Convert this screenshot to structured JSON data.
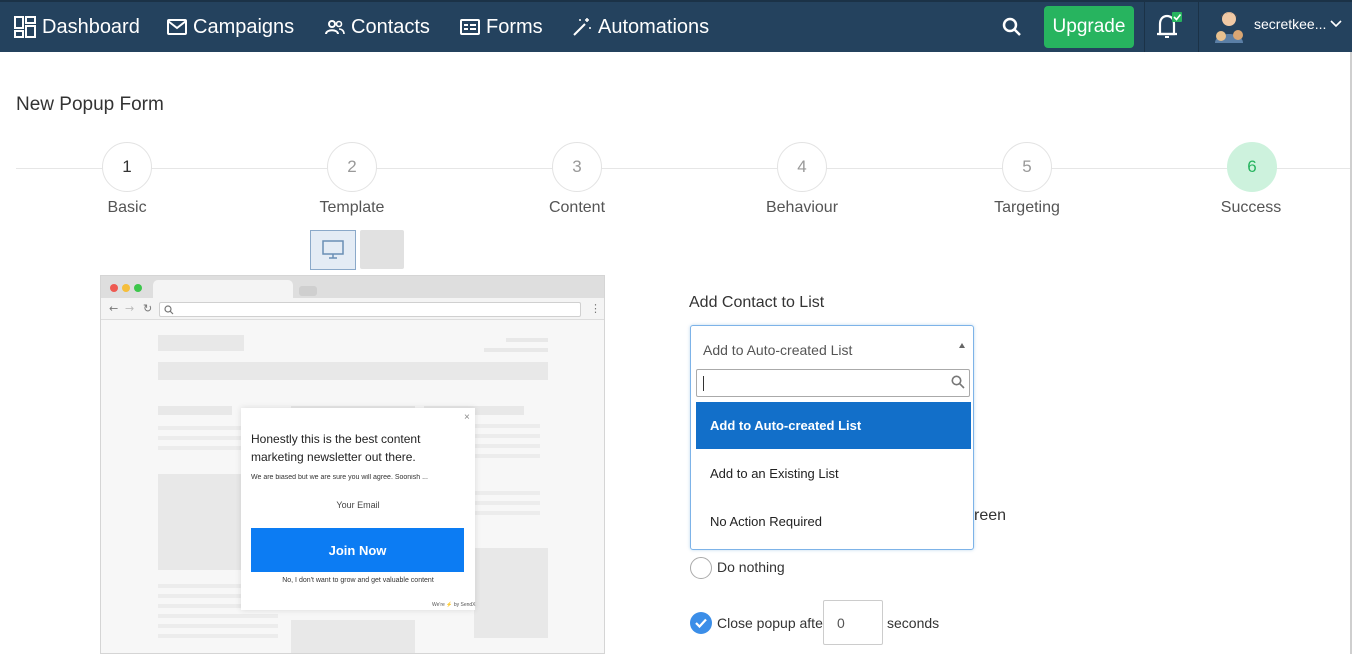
{
  "nav": {
    "items": [
      {
        "label": "Dashboard",
        "icon": "dashboard-icon"
      },
      {
        "label": "Campaigns",
        "icon": "envelope-icon"
      },
      {
        "label": "Contacts",
        "icon": "users-icon"
      },
      {
        "label": "Forms",
        "icon": "form-icon"
      },
      {
        "label": "Automations",
        "icon": "magic-wand-icon"
      }
    ],
    "upgrade_label": "Upgrade",
    "username": "secretkee...",
    "colors": {
      "bar": "#24425e",
      "upgrade": "#27b45f"
    }
  },
  "page": {
    "title": "New Popup Form"
  },
  "steps": [
    {
      "num": "1",
      "label": "Basic"
    },
    {
      "num": "2",
      "label": "Template"
    },
    {
      "num": "3",
      "label": "Content"
    },
    {
      "num": "4",
      "label": "Behaviour"
    },
    {
      "num": "5",
      "label": "Targeting"
    },
    {
      "num": "6",
      "label": "Success"
    }
  ],
  "preview": {
    "popup": {
      "close": "×",
      "headline": "Honestly this is the best content marketing newsletter out there.",
      "subtext": "We are biased but we are sure you will agree. Soonish ...",
      "email_placeholder": "Your Email",
      "button": "Join Now",
      "decline": "No, I don't want to grow and get valuable content",
      "badge": "We're ⚡ by SendX"
    }
  },
  "list": {
    "label": "Add Contact to List",
    "selected": "Add to Auto-created List",
    "options": [
      "Add to Auto-created List",
      "Add to an Existing List",
      "No Action Required"
    ]
  },
  "success": {
    "partial_heading": "reen",
    "do_nothing": "Do nothing",
    "close_after": "Close popup after",
    "seconds_value": "0",
    "seconds_label": "seconds"
  }
}
